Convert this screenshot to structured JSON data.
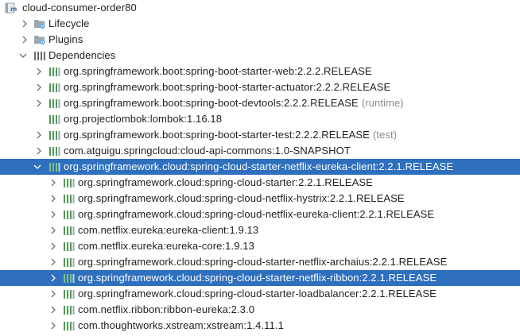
{
  "project": {
    "name": "cloud-consumer-order80",
    "icon": "maven-module-icon"
  },
  "folders": [
    {
      "label": "Lifecycle",
      "icon": "folder-gear-icon",
      "expanded": false
    },
    {
      "label": "Plugins",
      "icon": "folder-gear-icon",
      "expanded": false
    },
    {
      "label": "Dependencies",
      "icon": "library-bars-icon",
      "expanded": true
    }
  ],
  "dependencies": [
    {
      "label": "org.springframework.boot:spring-boot-starter-web:2.2.2.RELEASE",
      "scope": "",
      "expandable": true
    },
    {
      "label": "org.springframework.boot:spring-boot-starter-actuator:2.2.2.RELEASE",
      "scope": "",
      "expandable": true
    },
    {
      "label": "org.springframework.boot:spring-boot-devtools:2.2.2.RELEASE",
      "scope": "(runtime)",
      "expandable": true
    },
    {
      "label": "org.projectlombok:lombok:1.16.18",
      "scope": "",
      "expandable": false
    },
    {
      "label": "org.springframework.boot:spring-boot-starter-test:2.2.2.RELEASE",
      "scope": "(test)",
      "expandable": true
    },
    {
      "label": "com.atguigu.springcloud:cloud-api-commons:1.0-SNAPSHOT",
      "scope": "",
      "expandable": true
    },
    {
      "label": "org.springframework.cloud:spring-cloud-starter-netflix-eureka-client:2.2.1.RELEASE",
      "scope": "",
      "expandable": true,
      "expanded": true,
      "selected": true
    }
  ],
  "eureka_children": [
    {
      "label": "org.springframework.cloud:spring-cloud-starter:2.2.1.RELEASE",
      "selected": false
    },
    {
      "label": "org.springframework.cloud:spring-cloud-netflix-hystrix:2.2.1.RELEASE",
      "selected": false
    },
    {
      "label": "org.springframework.cloud:spring-cloud-netflix-eureka-client:2.2.1.RELEASE",
      "selected": false
    },
    {
      "label": "com.netflix.eureka:eureka-client:1.9.13",
      "selected": false
    },
    {
      "label": "com.netflix.eureka:eureka-core:1.9.13",
      "selected": false
    },
    {
      "label": "org.springframework.cloud:spring-cloud-starter-netflix-archaius:2.2.1.RELEASE",
      "selected": false
    },
    {
      "label": "org.springframework.cloud:spring-cloud-starter-netflix-ribbon:2.2.1.RELEASE",
      "selected": true
    },
    {
      "label": "org.springframework.cloud:spring-cloud-starter-loadbalancer:2.2.1.RELEASE",
      "selected": false
    },
    {
      "label": "com.netflix.ribbon:ribbon-eureka:2.3.0",
      "selected": false
    },
    {
      "label": "com.thoughtworks.xstream:xstream:1.4.11.1",
      "selected": false
    }
  ],
  "colors": {
    "selection": "#2e6fbe",
    "library_green": "#4e9a55",
    "arrow_gray": "#6e6e6e",
    "folder_gray": "#9aa7b0",
    "scope_gray": "#8c8c8c"
  }
}
